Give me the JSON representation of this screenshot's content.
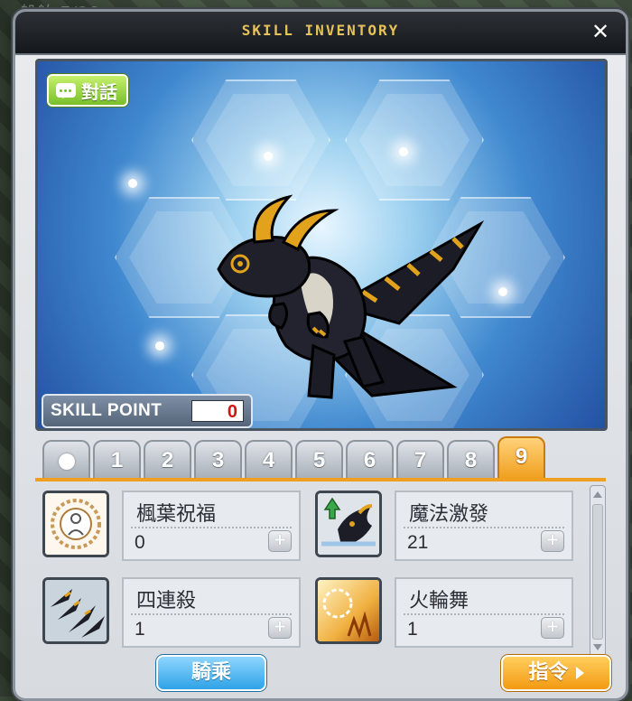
{
  "background_text": "船舶  7/28",
  "window": {
    "title": "SKILL INVENTORY",
    "close_label": "✕"
  },
  "portrait": {
    "chat_label": "對話",
    "skill_point_label": "SKILL POINT",
    "skill_point_value": "0"
  },
  "tabs": [
    {
      "label": "",
      "icon": "dot-icon",
      "active": false
    },
    {
      "label": "1",
      "active": false
    },
    {
      "label": "2",
      "active": false
    },
    {
      "label": "3",
      "active": false
    },
    {
      "label": "4",
      "active": false
    },
    {
      "label": "5",
      "active": false
    },
    {
      "label": "6",
      "active": false
    },
    {
      "label": "7",
      "active": false
    },
    {
      "label": "8",
      "active": false
    },
    {
      "label": "9",
      "active": true
    }
  ],
  "skills": [
    {
      "name": "楓葉祝福",
      "level": "0",
      "icon": "maple-blessing-icon"
    },
    {
      "name": "魔法激發",
      "level": "21",
      "icon": "magic-boost-icon"
    },
    {
      "name": "四連殺",
      "level": "1",
      "icon": "quad-kill-icon"
    },
    {
      "name": "火輪舞",
      "level": "1",
      "icon": "fire-wheel-icon"
    }
  ],
  "buttons": {
    "ride_label": "騎乘",
    "command_label": "指令"
  },
  "colors": {
    "accent_orange": "#f0a020",
    "title_gold": "#e6c25a",
    "skill_point_red": "#d21616",
    "chat_green": "#78bf2a",
    "ride_blue": "#2ea2e6"
  }
}
